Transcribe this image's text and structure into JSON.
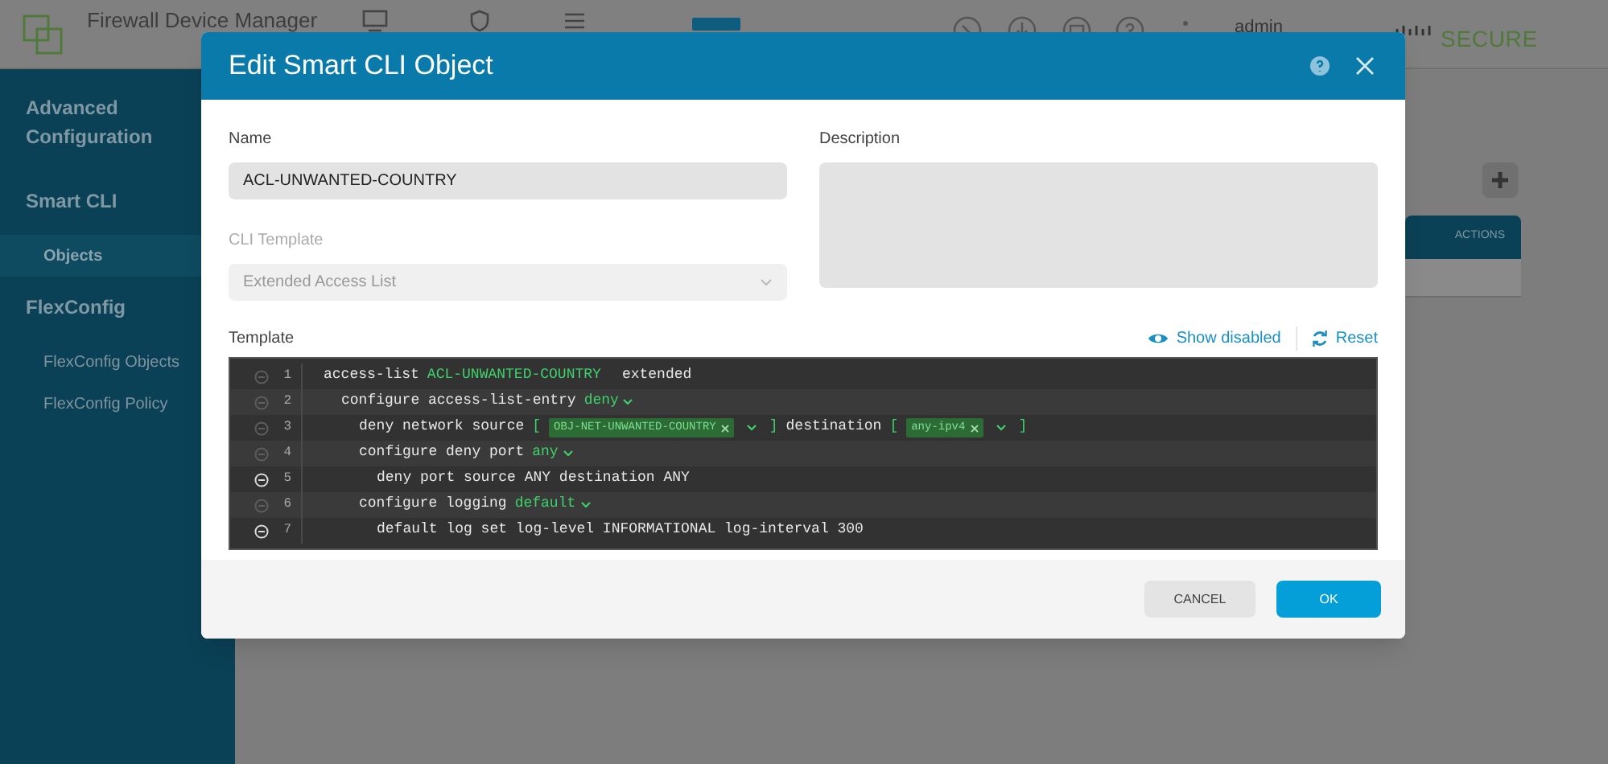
{
  "header": {
    "app_title": "Firewall Device Manager",
    "user": "admin",
    "brand": "SECURE"
  },
  "sidebar": {
    "sections": [
      {
        "title": "Advanced Configuration"
      },
      {
        "title": "Smart CLI",
        "items": [
          {
            "label": "Objects",
            "selected": true
          }
        ]
      },
      {
        "title": "FlexConfig",
        "items": [
          {
            "label": "FlexConfig Objects",
            "selected": false
          },
          {
            "label": "FlexConfig Policy",
            "selected": false
          }
        ]
      }
    ]
  },
  "table": {
    "columns": [
      "ACTIONS"
    ]
  },
  "dialog": {
    "title": "Edit Smart CLI Object",
    "name": {
      "label": "Name",
      "value": "ACL-UNWANTED-COUNTRY"
    },
    "cli_template": {
      "label": "CLI Template",
      "value": "Extended Access List",
      "disabled": true
    },
    "description": {
      "label": "Description"
    },
    "template": {
      "label": "Template",
      "actions": [
        {
          "label": "Show disabled",
          "kind": "eye"
        },
        {
          "label": "Reset",
          "kind": "reset"
        }
      ],
      "lines": [
        {
          "number": "1",
          "active": false,
          "segments": [
            {
              "kind": "text",
              "text": "access-list"
            },
            {
              "kind": "value",
              "text": "ACL-UNWANTED-COUNTRY"
            },
            {
              "kind": "text",
              "text": "extended"
            }
          ],
          "children": [
            {
              "number": "2",
              "active": false,
              "segments": [
                {
                  "kind": "text",
                  "text": "configure access-list-entry"
                },
                {
                  "kind": "dropdown",
                  "text": "deny"
                }
              ],
              "children": [
                {
                  "number": "3",
                  "active": false,
                  "segments": [
                    {
                      "kind": "text",
                      "text": "deny network source"
                    },
                    {
                      "kind": "bracket",
                      "text": "["
                    },
                    {
                      "kind": "tag",
                      "text": "OBJ-NET-UNWANTED-COUNTRY"
                    },
                    {
                      "kind": "select"
                    },
                    {
                      "kind": "bracket",
                      "text": "]"
                    },
                    {
                      "kind": "text",
                      "text": "destination"
                    },
                    {
                      "kind": "bracket",
                      "text": "["
                    },
                    {
                      "kind": "tag",
                      "text": "any-ipv4"
                    },
                    {
                      "kind": "select"
                    },
                    {
                      "kind": "bracket",
                      "text": "]"
                    }
                  ]
                },
                {
                  "number": "4",
                  "active": false,
                  "segments": [
                    {
                      "kind": "text",
                      "text": "configure deny port"
                    },
                    {
                      "kind": "dropdown",
                      "text": "any"
                    }
                  ],
                  "children": [
                    {
                      "number": "5",
                      "active": true,
                      "segments": [
                        {
                          "kind": "text",
                          "text": "deny port source ANY destination ANY"
                        }
                      ]
                    }
                  ]
                },
                {
                  "number": "6",
                  "active": false,
                  "segments": [
                    {
                      "kind": "text",
                      "text": "configure logging"
                    },
                    {
                      "kind": "dropdown",
                      "text": "default"
                    }
                  ],
                  "children": [
                    {
                      "number": "7",
                      "active": true,
                      "segments": [
                        {
                          "kind": "text",
                          "text": "default log set log-level INFORMATIONAL log-interval 300"
                        }
                      ]
                    }
                  ]
                }
              ]
            }
          ]
        }
      ]
    },
    "buttons": [
      {
        "label": "CANCEL",
        "kind": "secondary"
      },
      {
        "label": "OK",
        "kind": "primary"
      }
    ]
  }
}
